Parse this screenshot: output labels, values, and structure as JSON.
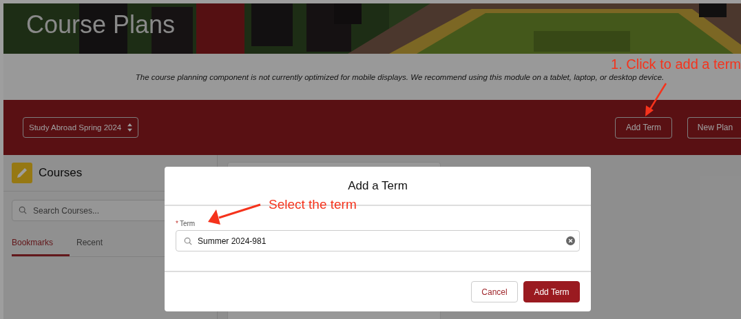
{
  "header": {
    "title": "Course Plans"
  },
  "notice": "The course planning component is not currently optimized for mobile displays. We recommend using this module on a tablet, laptop, or desktop device.",
  "toolbar": {
    "plan_select": "Study Abroad Spring 2024",
    "buttons": [
      "Add Term",
      "New Plan"
    ]
  },
  "courses_panel": {
    "title": "Courses",
    "search": {
      "placeholder": "Search Courses..."
    },
    "tabs": [
      {
        "label": "Bookmarks",
        "selected": true
      },
      {
        "label": "Recent",
        "selected": false
      }
    ]
  },
  "dialog": {
    "title": "Add a Term",
    "field": {
      "label": "Term",
      "required_mark": "*",
      "value": "Summer 2024-981"
    },
    "buttons": [
      {
        "label": "Cancel",
        "kind": "neutral"
      },
      {
        "label": "Add Term",
        "kind": "brand"
      }
    ]
  },
  "annotations": [
    {
      "text": "1. Click to add a term"
    },
    {
      "text": "Select the term"
    }
  ]
}
